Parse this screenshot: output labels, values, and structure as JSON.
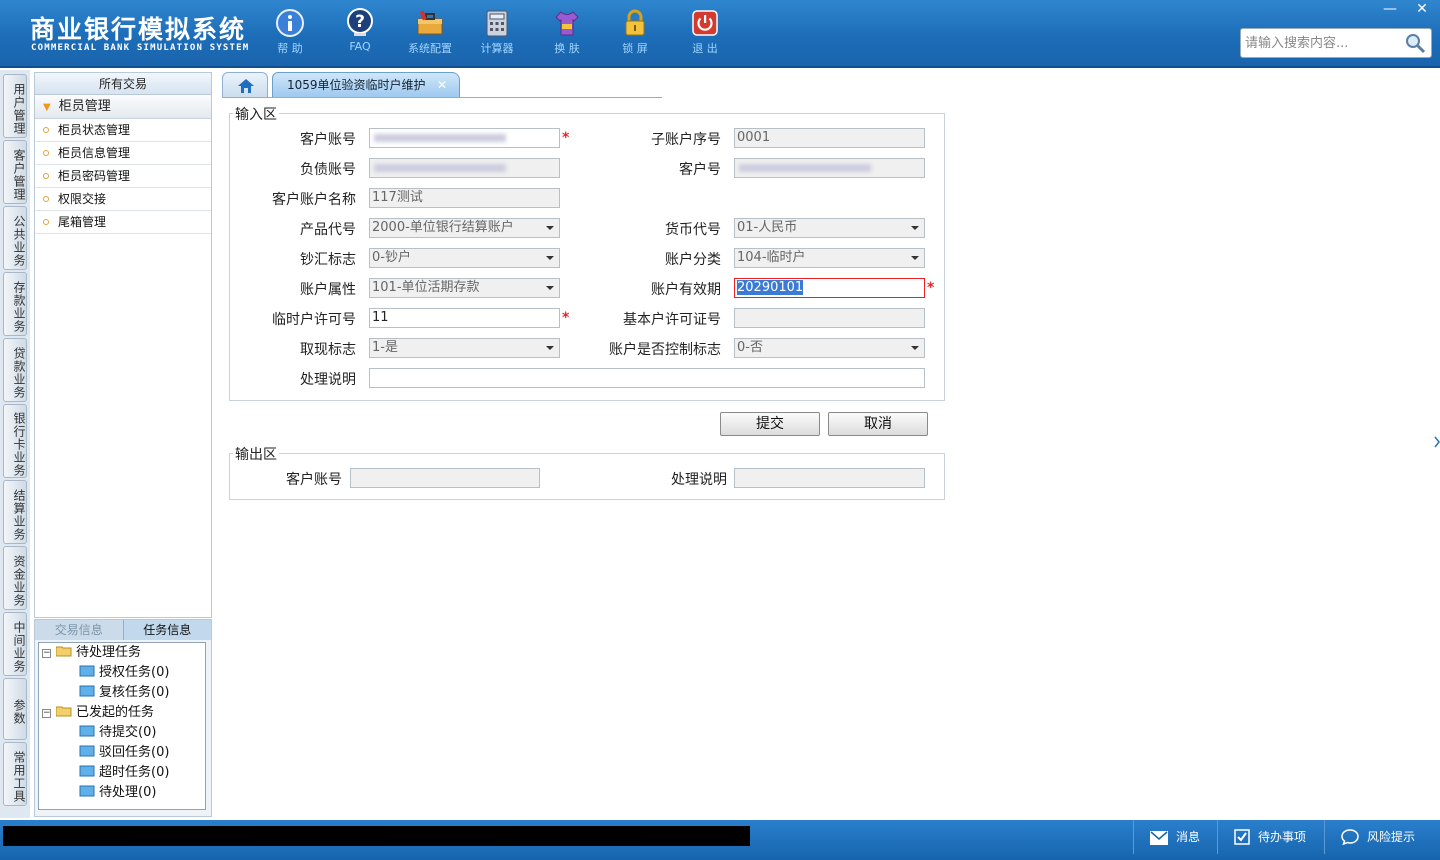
{
  "header": {
    "title": "商业银行模拟系统",
    "subtitle": "COMMERCIAL BANK SIMULATION SYSTEM",
    "toolbar": [
      {
        "label": "帮 助",
        "icon": "info-icon"
      },
      {
        "label": "FAQ",
        "icon": "question-icon"
      },
      {
        "label": "系统配置",
        "icon": "toolbox-icon"
      },
      {
        "label": "计算器",
        "icon": "calculator-icon"
      },
      {
        "label": "换 肤",
        "icon": "shirt-icon"
      },
      {
        "label": "锁 屏",
        "icon": "lock-icon"
      },
      {
        "label": "退 出",
        "icon": "power-icon"
      }
    ],
    "search_placeholder": "请输入搜索内容...",
    "minimize": "—",
    "close": "✕"
  },
  "vtabs": [
    "用户管理",
    "客户管理",
    "公共业务",
    "存款业务",
    "贷款业务",
    "银行卡业务",
    "结算业务",
    "资金业务",
    "中间业务",
    "参数",
    "常用工具"
  ],
  "nav": {
    "header": "所有交易",
    "group": "柜员管理",
    "items": [
      "柜员状态管理",
      "柜员信息管理",
      "柜员密码管理",
      "权限交接",
      "尾箱管理"
    ]
  },
  "task_panel": {
    "tabs": [
      "交易信息",
      "任务信息"
    ],
    "tree": [
      {
        "label": "待处理任务",
        "level": 0
      },
      {
        "label": "授权任务(0)",
        "level": 1
      },
      {
        "label": "复核任务(0)",
        "level": 1
      },
      {
        "label": "已发起的任务",
        "level": 0
      },
      {
        "label": "待提交(0)",
        "level": 1
      },
      {
        "label": "驳回任务(0)",
        "level": 1
      },
      {
        "label": "超时任务(0)",
        "level": 1
      },
      {
        "label": "待处理(0)",
        "level": 1
      }
    ]
  },
  "tabs": {
    "active": "1059单位验资临时户维护",
    "close": "✕"
  },
  "input_area": {
    "title": "输入区",
    "fields": {
      "customer_account": {
        "label": "客户账号",
        "value": ""
      },
      "sub_account_seq": {
        "label": "子账户序号",
        "value": "0001"
      },
      "liability_account": {
        "label": "负债账号",
        "value": ""
      },
      "customer_no": {
        "label": "客户号",
        "value": ""
      },
      "account_name": {
        "label": "客户账户名称",
        "value": "117测试"
      },
      "product_code": {
        "label": "产品代号",
        "value": "2000-单位银行结算账户"
      },
      "currency_code": {
        "label": "货币代号",
        "value": "01-人民币"
      },
      "cash_flag": {
        "label": "钞汇标志",
        "value": "0-钞户"
      },
      "account_class": {
        "label": "账户分类",
        "value": "104-临时户"
      },
      "account_attr": {
        "label": "账户属性",
        "value": "101-单位活期存款"
      },
      "valid_date": {
        "label": "账户有效期",
        "value": "20290101"
      },
      "temp_permit": {
        "label": "临时户许可号",
        "value": "11"
      },
      "basic_permit": {
        "label": "基本户许可证号",
        "value": ""
      },
      "withdraw_flag": {
        "label": "取现标志",
        "value": "1-是"
      },
      "control_flag": {
        "label": "账户是否控制标志",
        "value": "0-否"
      },
      "remark": {
        "label": "处理说明",
        "value": ""
      }
    },
    "required_mark": "*"
  },
  "buttons": {
    "submit": "提交",
    "cancel": "取消"
  },
  "output_area": {
    "title": "输出区",
    "customer_account_label": "客户账号",
    "remark_label": "处理说明"
  },
  "statusbar": {
    "messages": "消息",
    "todo": "待办事项",
    "risk": "风险提示"
  }
}
